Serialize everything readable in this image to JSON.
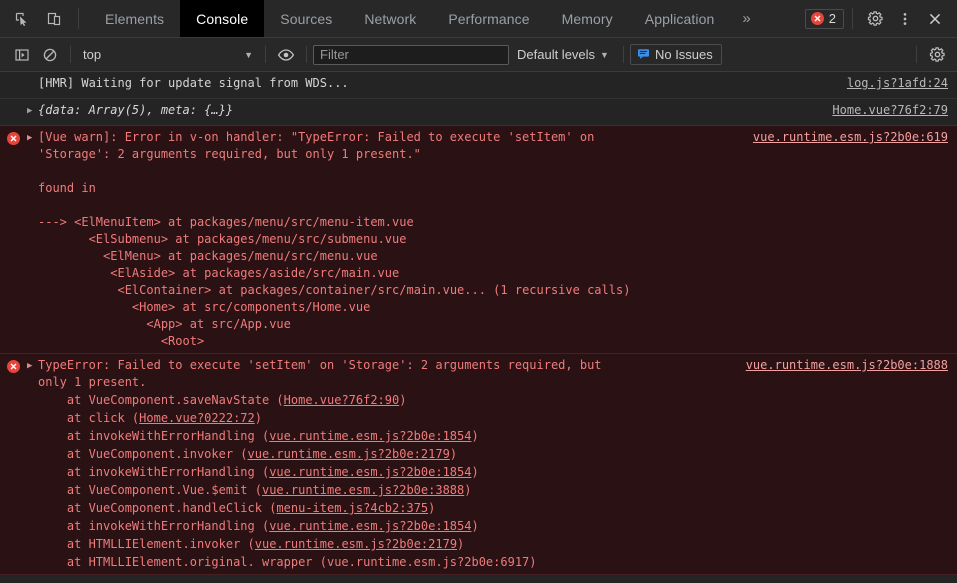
{
  "window": {
    "title": "Chrome DevTools"
  },
  "tabbar": {
    "inspect_icon": "inspect-cursor-icon",
    "device_icon": "device-toolbar-icon",
    "tabs": [
      {
        "label": "Elements",
        "active": false
      },
      {
        "label": "Console",
        "active": true
      },
      {
        "label": "Sources",
        "active": false
      },
      {
        "label": "Network",
        "active": false
      },
      {
        "label": "Performance",
        "active": false
      },
      {
        "label": "Memory",
        "active": false
      },
      {
        "label": "Application",
        "active": false
      }
    ],
    "more_tabs_label": "»",
    "error_count": "2",
    "settings_icon": "gear-icon",
    "more_options_icon": "kebab-menu-icon",
    "close_icon": "close-icon"
  },
  "console_toolbar": {
    "sidebar_toggle_icon": "console-sidebar-icon",
    "clear_icon": "clear-console-icon",
    "context_value": "top",
    "context_caret": "▼",
    "eye_icon": "live-expression-eye-icon",
    "filter_placeholder": "Filter",
    "filter_value": "",
    "levels_label": "Default levels",
    "levels_caret": "▼",
    "issues_label": "No Issues",
    "issues_icon": "issues-flag-icon",
    "settings_icon": "console-settings-gear-icon"
  },
  "messages": [
    {
      "type": "info",
      "arrow": "",
      "text": "[HMR] Waiting for update signal from WDS...",
      "source": "log.js?1afd:24"
    },
    {
      "type": "info",
      "arrow": "▶",
      "text": "{data: Array(5), meta: {…}}",
      "italic": true,
      "source": "Home.vue?76f2:79"
    },
    {
      "type": "error",
      "arrow": "▶",
      "icon": "error-circle-icon",
      "text": "[Vue warn]: Error in v-on handler: \"TypeError: Failed to execute 'setItem' on\n'Storage': 2 arguments required, but only 1 present.\"\n\nfound in\n\n---> <ElMenuItem> at packages/menu/src/menu-item.vue\n       <ElSubmenu> at packages/menu/src/submenu.vue\n         <ElMenu> at packages/menu/src/menu.vue\n          <ElAside> at packages/aside/src/main.vue\n           <ElContainer> at packages/container/src/main.vue... (1 recursive calls)\n             <Home> at src/components/Home.vue\n               <App> at src/App.vue\n                 <Root>",
      "source": "vue.runtime.esm.js?2b0e:619"
    },
    {
      "type": "error",
      "arrow": "▶",
      "icon": "error-circle-icon",
      "text": "TypeError: Failed to execute 'setItem' on 'Storage': 2 arguments required, but\nonly 1 present.",
      "source": "vue.runtime.esm.js?2b0e:1888",
      "stack": [
        {
          "prefix": "    at VueComponent.saveNavState (",
          "link": "Home.vue?76f2:90",
          "suffix": ")"
        },
        {
          "prefix": "    at click (",
          "link": "Home.vue?0222:72",
          "suffix": ")"
        },
        {
          "prefix": "    at invokeWithErrorHandling (",
          "link": "vue.runtime.esm.js?2b0e:1854",
          "suffix": ")"
        },
        {
          "prefix": "    at VueComponent.invoker (",
          "link": "vue.runtime.esm.js?2b0e:2179",
          "suffix": ")"
        },
        {
          "prefix": "    at invokeWithErrorHandling (",
          "link": "vue.runtime.esm.js?2b0e:1854",
          "suffix": ")"
        },
        {
          "prefix": "    at VueComponent.Vue.$emit (",
          "link": "vue.runtime.esm.js?2b0e:3888",
          "suffix": ")"
        },
        {
          "prefix": "    at VueComponent.handleClick (",
          "link": "menu-item.js?4cb2:375",
          "suffix": ")"
        },
        {
          "prefix": "    at invokeWithErrorHandling (",
          "link": "vue.runtime.esm.js?2b0e:1854",
          "suffix": ")"
        },
        {
          "prefix": "    at HTMLLIElement.invoker (",
          "link": "vue.runtime.esm.js?2b0e:2179",
          "suffix": ")"
        },
        {
          "prefix": "    at HTMLLIElement.original. wrapper (vue.runtime.esm.js?2b0e:6917)",
          "link": "",
          "suffix": ""
        }
      ]
    }
  ],
  "colors": {
    "background": "#242424",
    "toolbar": "#282828",
    "error_background": "#2a1113",
    "error_text": "#f07b7b",
    "error_accent": "#e8443a",
    "link": "#b8b8b8",
    "active_tab_background": "#000000",
    "issues_blue": "#3b8eea"
  }
}
